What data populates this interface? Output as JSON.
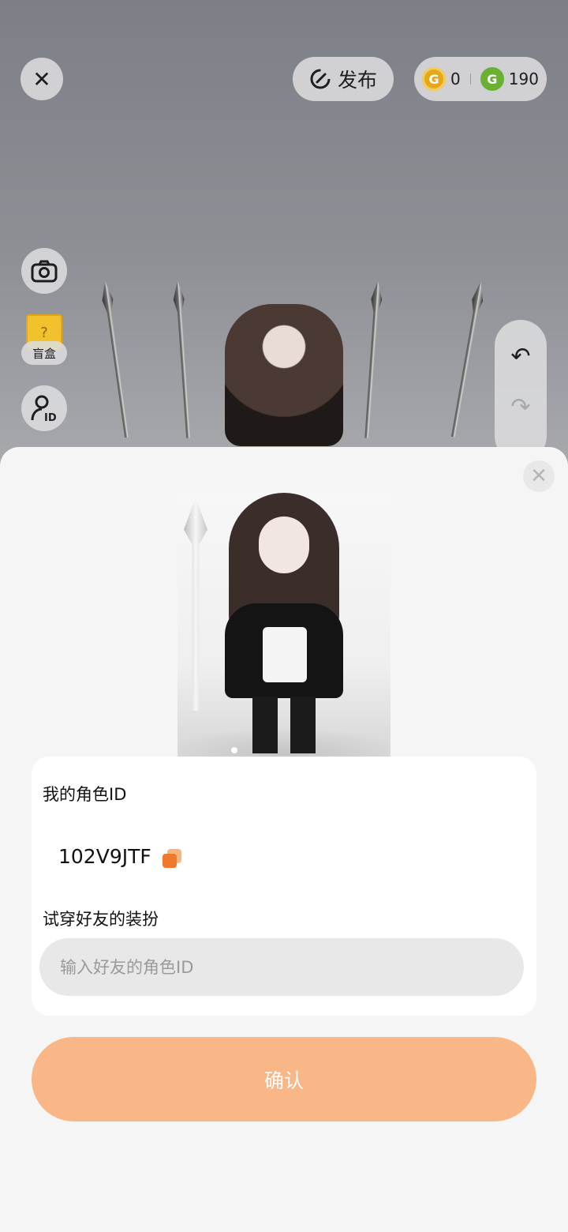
{
  "top_bar": {
    "close_icon": "close-icon",
    "publish_label": "发布",
    "gold_coin_count": "0",
    "green_coin_count": "190"
  },
  "side": {
    "blindbox_label": "盲盒",
    "camera_icon": "camera-icon",
    "id_icon": "person-id-icon"
  },
  "history": {
    "undo_icon": "undo-icon",
    "redo_icon": "redo-icon"
  },
  "sheet": {
    "my_id_label": "我的角色ID",
    "my_id_value": "102V9JTF",
    "try_on_label": "试穿好友的装扮",
    "friend_id_placeholder": "输入好友的角色ID",
    "confirm_label": "确认"
  },
  "colors": {
    "confirm_button": "#f9b686",
    "copy_icon": "#f07a2c",
    "gold_coin": "#e6a818",
    "green_coin": "#6ab033"
  }
}
